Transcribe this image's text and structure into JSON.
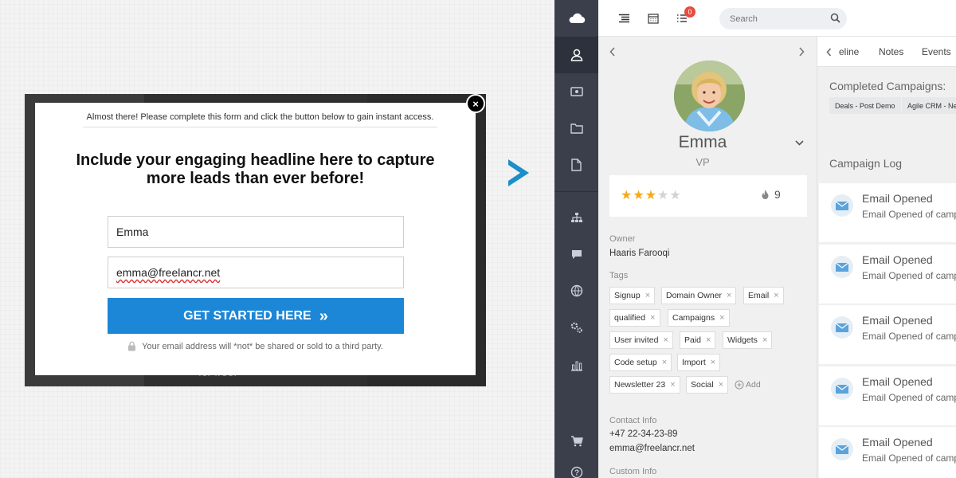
{
  "popup": {
    "note": "Almost there! Please complete this form and click the button below to gain instant access.",
    "headline": "Include your engaging headline here to capture more leads than ever before!",
    "name_value": "Emma",
    "email_value": "emma@freelancr.net",
    "cta_label": "GET STARTED HERE",
    "cta_icon": "double-chevron-right-icon",
    "privacy_text": "Your email address will *not* be shared or sold to a third party.",
    "close_label": "×",
    "background_fragment": "for free!"
  },
  "crm": {
    "search": {
      "placeholder": "Search"
    },
    "notifications": {
      "count": "0"
    },
    "rail_icons": [
      "cloud-logo-icon",
      "contacts-icon",
      "deals-icon",
      "folder-icon",
      "document-icon",
      "org-chart-icon",
      "chat-icon",
      "globe-icon",
      "settings-icon",
      "reports-icon",
      "cart-icon",
      "help-icon"
    ],
    "contact": {
      "name": "Emma",
      "title": "VP",
      "star_rating": 3,
      "star_max": 5,
      "score": "9",
      "owner_label": "Owner",
      "owner": "Haaris Farooqi",
      "tags_label": "Tags",
      "tags": [
        "Signup",
        "Domain Owner",
        "Email",
        "qualified",
        "Campaigns",
        "User invited",
        "Paid",
        "Widgets",
        "Code setup",
        "Import",
        "Newsletter 23",
        "Social"
      ],
      "add_tag_label": "Add",
      "contact_info_label": "Contact Info",
      "phone": "+47 22-34-23-89",
      "email": "emma@freelancr.net",
      "custom_info_label": "Custom Info"
    },
    "timeline": {
      "tabs": [
        "eline",
        "Notes",
        "Events"
      ],
      "completed_title": "Completed Campaigns:",
      "completed": [
        "Deals - Post Demo",
        "Agile CRM - New"
      ],
      "log_title": "Campaign Log",
      "log": [
        {
          "title": "Email Opened",
          "sub": "Email Opened of campaign"
        },
        {
          "title": "Email Opened",
          "sub": "Email Opened of campaign"
        },
        {
          "title": "Email Opened",
          "sub": "Email Opened of campaign"
        },
        {
          "title": "Email Opened",
          "sub": "Email Opened of campaign"
        },
        {
          "title": "Email Opened",
          "sub": "Email Opened of campaign"
        }
      ]
    }
  },
  "colors": {
    "cta": "#1b87d6",
    "rail": "#3a3f4b",
    "star": "#f4a81d",
    "badge": "#e74c3c",
    "arrow": "#1b8fc8"
  }
}
